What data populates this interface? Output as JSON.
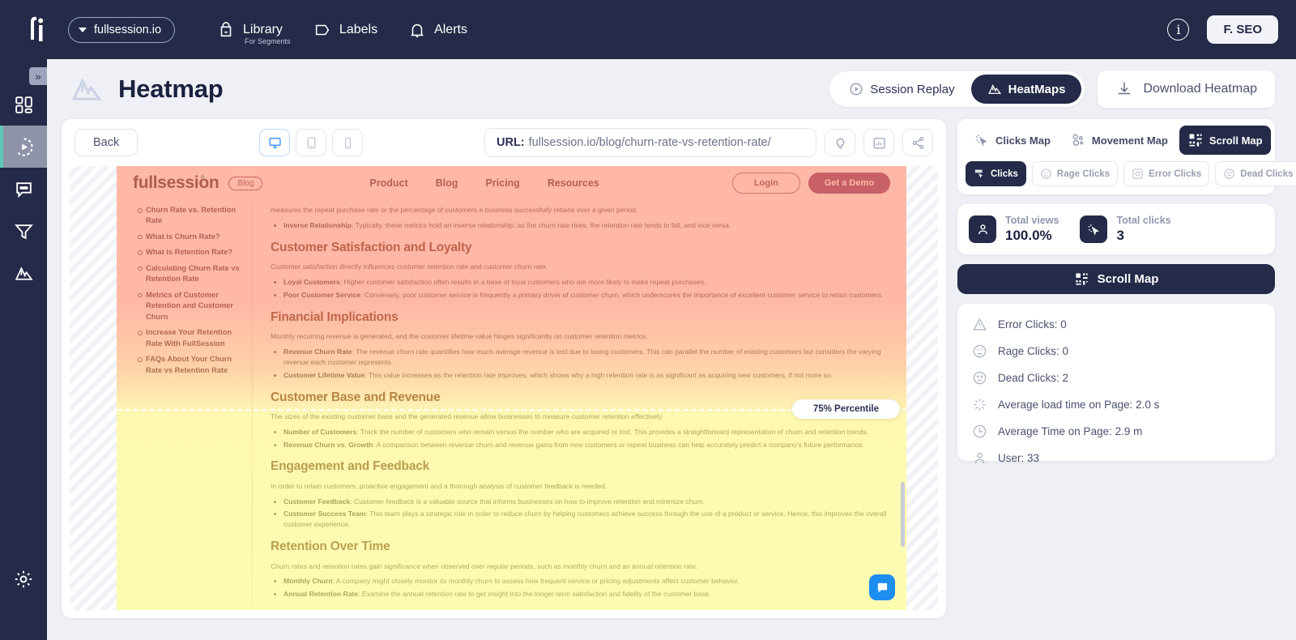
{
  "topbar": {
    "logo": "fi-logo",
    "site_selector": "fullsession.io",
    "nav": [
      {
        "label": "Library",
        "sub": "For Segments",
        "icon": "library-icon"
      },
      {
        "label": "Labels",
        "sub": "",
        "icon": "label-tag-icon"
      },
      {
        "label": "Alerts",
        "sub": "",
        "icon": "bell-icon"
      }
    ],
    "info_glyph": "i",
    "user": "F. SEO"
  },
  "rail": {
    "expand_glyph": "»",
    "items": [
      {
        "name": "dashboard",
        "icon": "dashboard-grid-icon"
      },
      {
        "name": "session-replay",
        "icon": "play-circle-icon",
        "active": true
      },
      {
        "name": "feedback",
        "icon": "chat-bubble-icon"
      },
      {
        "name": "funnels",
        "icon": "funnel-icon"
      },
      {
        "name": "heatmaps",
        "icon": "heatmap-mountain-icon"
      }
    ],
    "settings_icon": "gear-icon"
  },
  "header": {
    "title": "Heatmap",
    "logo_icon": "heatmap-mountain-icon",
    "mode_tabs": [
      {
        "label": "Session Replay",
        "icon": "play-circle-icon",
        "active": false
      },
      {
        "label": "HeatMaps",
        "icon": "heatmap-mountain-icon",
        "active": true
      }
    ],
    "download_label": "Download Heatmap",
    "download_icon": "download-icon"
  },
  "toolbar": {
    "back_label": "Back",
    "devices": [
      {
        "name": "desktop",
        "icon": "monitor-icon",
        "active": true
      },
      {
        "name": "tablet",
        "icon": "tablet-icon",
        "active": false
      },
      {
        "name": "mobile",
        "icon": "phone-icon",
        "active": false
      }
    ],
    "url_prefix": "URL:",
    "url_value": "fullsession.io/blog/churn-rate-vs-retention-rate/",
    "tools": [
      {
        "name": "insights",
        "icon": "lightbulb-icon"
      },
      {
        "name": "analytics",
        "icon": "bar-chart-icon"
      },
      {
        "name": "share",
        "icon": "share-icon"
      }
    ]
  },
  "viewport": {
    "percentile_label": "75% Percentile",
    "chat_icon": "chat-bubble-icon"
  },
  "page": {
    "logo": "fullsession",
    "tag": "Blog",
    "links": [
      "Product",
      "Blog",
      "Pricing",
      "Resources"
    ],
    "login": "Login",
    "demo": "Get a Demo",
    "toc": [
      "Churn Rate vs. Retention Rate",
      "What is Churn Rate?",
      "What is Retention Rate?",
      "Calculating Churn Rate vs Retention Rate",
      "Metrics of Customer Retention and Customer Churn",
      "Increase Your Retention Rate With FullSession",
      "FAQs About Your Churn Rate vs Retention Rate"
    ],
    "intro_partial": "measures the repeat purchase rate or the percentage of customers a business successfully retains over a given period.",
    "intro_bullet_term": "Inverse Relationship",
    "intro_bullet_text": ": Typically, these metrics hold an inverse relationship; as the churn rate rises, the retention rate tends to fall, and vice versa.",
    "sections": [
      {
        "heading": "Customer Satisfaction and Loyalty",
        "intro": "Customer satisfaction directly influences customer retention rate and customer churn rate.",
        "bullets": [
          {
            "term": "Loyal Customers",
            "text": ": Higher customer satisfaction often results in a base of loyal customers who are more likely to make repeat purchases."
          },
          {
            "term": "Poor Customer Service",
            "text": ": Conversely, poor customer service is frequently a primary driver of customer churn, which underscores the importance of excellent customer service to retain customers."
          }
        ]
      },
      {
        "heading": "Financial Implications",
        "intro": "Monthly recurring revenue is generated, and the customer lifetime value hinges significantly on customer retention metrics.",
        "bullets": [
          {
            "term": "Revenue Churn Rate",
            "text": ": The revenue churn rate quantifies how much average revenue is lost due to losing customers. This can parallel the number of existing customers but considers the varying revenue each customer represents."
          },
          {
            "term": "Customer Lifetime Value",
            "text": ": This value increases as the retention rate improves, which shows why a high retention rate is as significant as acquiring new customers, if not more so."
          }
        ]
      },
      {
        "heading": "Customer Base and Revenue",
        "intro": "The sizes of the existing customer base and the generated revenue allow businesses to measure customer retention effectively.",
        "bullets": [
          {
            "term": "Number of Customers",
            "text": ": Track the number of customers who remain versus the number who are acquired or lost. This provides a straightforward representation of churn and retention trends."
          },
          {
            "term": "Revenue Churn vs. Growth",
            "text": ": A comparison between revenue churn and revenue gains from new customers or repeat business can help accurately predict a company's future performance."
          }
        ]
      },
      {
        "heading": "Engagement and Feedback",
        "intro": "In order to retain customers, proactive engagement and a thorough analysis of customer feedback is needed.",
        "bullets": [
          {
            "term": "Customer Feedback",
            "text": ": Customer feedback is a valuable source that informs businesses on how to improve retention and minimize churn."
          },
          {
            "term": "Customer Success Team",
            "text": ": This team plays a strategic role in order to reduce churn by helping customers achieve success through the use of a product or service. Hence, this improves the overall customer experience."
          }
        ]
      },
      {
        "heading": "Retention Over Time",
        "intro": "Churn rates and retention rates gain significance when observed over regular periods, such as monthly churn and an annual retention rate.",
        "bullets": [
          {
            "term": "Monthly Churn",
            "text": ": A company might closely monitor its monthly churn to assess how frequent service or pricing adjustments affect customer behavior."
          },
          {
            "term": "Annual Retention Rate",
            "text": ": Examine the annual retention rate to get insight into the longer-term satisfaction and fidelity of the customer base."
          }
        ]
      }
    ]
  },
  "panel": {
    "map_tabs": [
      {
        "label": "Clicks Map",
        "icon": "cursor-click-icon",
        "active": false
      },
      {
        "label": "Movement Map",
        "icon": "movement-dots-icon",
        "active": false
      },
      {
        "label": "Scroll Map",
        "icon": "scroll-grid-icon",
        "active": true
      }
    ],
    "click_tabs": [
      {
        "label": "Clicks",
        "icon": "cursor-icon",
        "active": true
      },
      {
        "label": "Rage Clicks",
        "icon": "angry-face-icon",
        "active": false
      },
      {
        "label": "Error Clicks",
        "icon": "error-circle-icon",
        "active": false
      },
      {
        "label": "Dead Clicks",
        "icon": "neutral-face-icon",
        "active": false
      }
    ],
    "stats": [
      {
        "label": "Total views",
        "value": "100.0%",
        "icon": "users-icon"
      },
      {
        "label": "Total clicks",
        "value": "3",
        "icon": "cursor-click-icon"
      }
    ],
    "banner_label": "Scroll Map",
    "banner_icon": "scroll-grid-icon",
    "details": [
      {
        "label": "Error Clicks: 0",
        "icon": "warning-triangle-icon"
      },
      {
        "label": "Rage Clicks: 0",
        "icon": "angry-face-icon"
      },
      {
        "label": "Dead Clicks: 2",
        "icon": "dead-face-icon"
      },
      {
        "label": "Average load time on Page: 2.0 s",
        "icon": "loading-burst-icon"
      },
      {
        "label": "Average Time on Page: 2.9 m",
        "icon": "clock-icon"
      },
      {
        "label": "User: 33",
        "icon": "user-icon"
      }
    ]
  },
  "colors": {
    "navy": "#242a48",
    "accent_blue": "#1d8df0",
    "teal": "#5ec9b8",
    "heat_hot": "#ff8c6e",
    "heat_cool": "#fafa7d"
  }
}
